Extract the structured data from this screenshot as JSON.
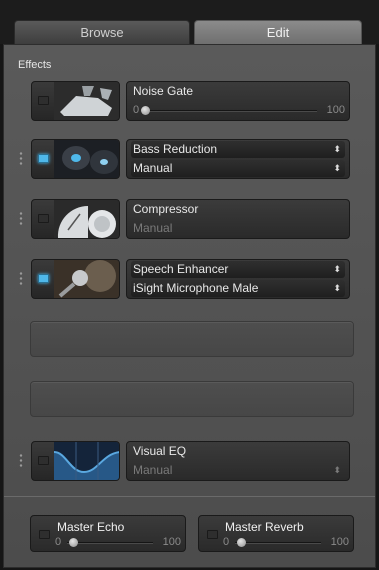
{
  "tabs": {
    "browse": "Browse",
    "edit": "Edit",
    "active": "edit"
  },
  "section_title": "Effects",
  "effects": [
    {
      "name": "Noise Gate",
      "enabled": false,
      "control": "slider",
      "min_label": "0",
      "max_label": "100",
      "value": 0
    },
    {
      "name": "Bass Reduction",
      "enabled": true,
      "control": "select",
      "preset": "Manual",
      "preset_enabled": true
    },
    {
      "name": "Compressor",
      "enabled": false,
      "control": "text",
      "preset": "Manual",
      "preset_enabled": false
    },
    {
      "name": "Speech Enhancer",
      "enabled": true,
      "control": "select",
      "preset": "iSight Microphone Male",
      "preset_enabled": true
    },
    {
      "name": "Visual EQ",
      "enabled": false,
      "control": "select",
      "preset": "Manual",
      "preset_enabled": false
    }
  ],
  "master": {
    "echo": {
      "label": "Master Echo",
      "enabled": false,
      "min_label": "0",
      "max_label": "100",
      "value": 0
    },
    "reverb": {
      "label": "Master Reverb",
      "enabled": false,
      "min_label": "0",
      "max_label": "100",
      "value": 0
    }
  },
  "colors": {
    "power_on": "#4fb8ea",
    "eq_curve": "#5aa8e0"
  }
}
